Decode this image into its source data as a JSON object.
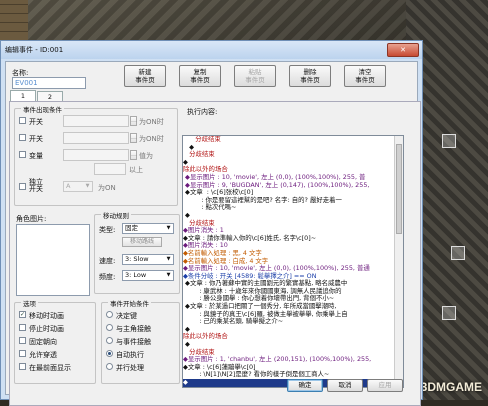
{
  "window": {
    "title": "编辑事件 - ID:001",
    "close": "✕"
  },
  "name": {
    "label": "名称:",
    "value": "EV001"
  },
  "toolbar": [
    {
      "line1": "新建",
      "line2": "事件页",
      "enabled": true
    },
    {
      "line1": "复制",
      "line2": "事件页",
      "enabled": true
    },
    {
      "line1": "粘贴",
      "line2": "事件页",
      "enabled": false
    },
    {
      "line1": "删除",
      "line2": "事件页",
      "enabled": true
    },
    {
      "line1": "清空",
      "line2": "事件页",
      "enabled": true
    }
  ],
  "tabs": [
    "1",
    "2"
  ],
  "conditions": {
    "title": "事件出现条件",
    "switch1": "开关",
    "switch1_suffix": "为ON时",
    "switch2": "开关",
    "switch2_suffix": "为ON时",
    "variable": "变量",
    "variable_suffix": "值为",
    "variable_suffix2": "以上",
    "self_switch": "独立开关",
    "self_switch_suffix": "为ON",
    "self_value": "A"
  },
  "image": {
    "title": "角色图片:"
  },
  "movement": {
    "title": "移动规则",
    "type_label": "类型:",
    "type_value": "固定",
    "route_button": "移动路线",
    "speed_label": "速度:",
    "speed_value": "3: Slow",
    "freq_label": "频度:",
    "freq_value": "3: Low"
  },
  "options": {
    "title": "选项",
    "items": [
      {
        "label": "移动时动画",
        "checked": true
      },
      {
        "label": "停止时动画",
        "checked": false
      },
      {
        "label": "固定朝向",
        "checked": false
      },
      {
        "label": "允许穿透",
        "checked": false
      },
      {
        "label": "在最前面显示",
        "checked": false
      }
    ]
  },
  "trigger": {
    "title": "事件开始条件",
    "items": [
      {
        "label": "决定键",
        "checked": false
      },
      {
        "label": "与主角接触",
        "checked": false
      },
      {
        "label": "与事件接触",
        "checked": false
      },
      {
        "label": "自动执行",
        "checked": true
      },
      {
        "label": "并行处理",
        "checked": false
      }
    ]
  },
  "script": {
    "title": "执行内容:",
    "lines": [
      {
        "t": "      分歧结束",
        "c": "c-red"
      },
      {
        "t": "   ◆",
        "c": "c-blk"
      },
      {
        "t": "   分歧结束",
        "c": "c-red"
      },
      {
        "t": "◆",
        "c": "c-blk"
      },
      {
        "t": "除此以外的场合",
        "c": "c-red"
      },
      {
        "t": " ◆显示图片 : 10, 'movie', 左上 (0,0), (100%,100%), 255, 普",
        "c": "c-pur"
      },
      {
        "t": " ◆显示图片 : 9, 'BUGDAN', 左上 (0,147), (100%,100%), 255,",
        "c": "c-pur"
      },
      {
        "t": " ◆文章  : \\c[6]张校\\c[0]",
        "c": "c-blk"
      },
      {
        "t": "         : 你是要留這裡幫的是吧? 名字: 自的? 嚴好走着一",
        "c": "c-blk"
      },
      {
        "t": "         : 點次代嗎~",
        "c": "c-blk"
      },
      {
        "t": " ◆",
        "c": "c-blk"
      },
      {
        "t": "   分歧结束",
        "c": "c-red"
      },
      {
        "t": "◆图片消失 : 1",
        "c": "c-pur"
      },
      {
        "t": "◆文章 : 請你準輸入你的\\c[6]姓氏, 名字\\c[0]~",
        "c": "c-blk"
      },
      {
        "t": "◆图片消失 : 10",
        "c": "c-pur"
      },
      {
        "t": "◆名前輸入処理 : 黑, 4 文字",
        "c": "c-org"
      },
      {
        "t": "◆名前輸入処理 : 白成, 4 文字",
        "c": "c-org"
      },
      {
        "t": "◆显示图片 : 10, 'movie', 左上 (0,0), (100%,100%), 255, 普通",
        "c": "c-pur"
      },
      {
        "t": "◆条件分岐 : 开关 [4589: 鬆擧擇之介] == ON",
        "c": "c-blu"
      },
      {
        "t": " ◆文章 : 你乃著蘇中實的主國劉元的繁實基點, 略名威農中",
        "c": "c-blk"
      },
      {
        "t": "        : 康武林 : 十歲年來你國國東海, 調無人民議追你的",
        "c": "c-blk"
      },
      {
        "t": "        : 勝公身國擧 : 你心想着你壞帶出門, 背個不小~",
        "c": "c-blk"
      },
      {
        "t": " ◆文章 : 於某過口把關了一個秀分, 年所成當國擊潮時,",
        "c": "c-blk"
      },
      {
        "t": "        : 與鏡子的真王\\c[6]羅, 被做主擧被擧擧, 你乘擧上自",
        "c": "c-blk"
      },
      {
        "t": "        : 己的乘某名頭, 騎擧擬之介~",
        "c": "c-blk"
      },
      {
        "t": " ◆",
        "c": "c-blk"
      },
      {
        "t": "除此以外的场合",
        "c": "c-red"
      },
      {
        "t": " ◆",
        "c": "c-blk"
      },
      {
        "t": "   分歧结束",
        "c": "c-red"
      },
      {
        "t": "◆显示图片 : 1, 'chanbu', 左上 (200,151), (100%,100%), 255,",
        "c": "c-pur"
      },
      {
        "t": "◆文章 : \\c[6]蓮蹦擧\\c[0]",
        "c": "c-blk"
      },
      {
        "t": "        : \\N[1]\\N[2]是麼? 看你的樣子倒是個工商人~",
        "c": "c-blk"
      },
      {
        "t": "◆",
        "c": "hl"
      }
    ]
  },
  "buttons": {
    "ok": "确定",
    "cancel": "取消",
    "apply": "应用"
  },
  "watermark": "3DMGAME"
}
